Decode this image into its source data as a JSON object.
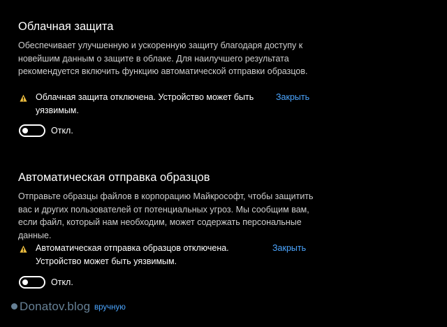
{
  "colors": {
    "background": "#000000",
    "accent_link": "#4ca6ff",
    "warning_icon": "#f0c040",
    "text_primary": "#ffffff",
    "text_secondary": "#cfcfcf"
  },
  "cloud_protection": {
    "title": "Облачная защита",
    "description": "Обеспечивает улучшенную и ускоренную защиту благодаря доступу к новейшим данным о защите в облаке. Для наилучшего результата рекомендуется включить функцию автоматической отправки образцов.",
    "warning": {
      "icon": "warning-triangle-icon",
      "text": "Облачная защита отключена. Устройство может быть уязвимым.",
      "dismiss_label": "Закрыть"
    },
    "toggle": {
      "state": "off",
      "label": "Откл."
    }
  },
  "sample_submission": {
    "title": "Автоматическая отправка образцов",
    "description": "Отправьте образцы файлов в корпорацию Майкрософт, чтобы защитить вас и других пользователей от потенциальных угроз. Мы сообщим вам, если файл, который нам необходим, может содержать персональные данные.",
    "warning": {
      "icon": "warning-triangle-icon",
      "text": "Автоматическая отправка образцов отключена. Устройство может быть уязвимым.",
      "dismiss_label": "Закрыть"
    },
    "toggle": {
      "state": "off",
      "label": "Откл."
    }
  },
  "bottom_link": {
    "text": "вручную"
  },
  "watermark": {
    "text": "Donatov.blog"
  }
}
